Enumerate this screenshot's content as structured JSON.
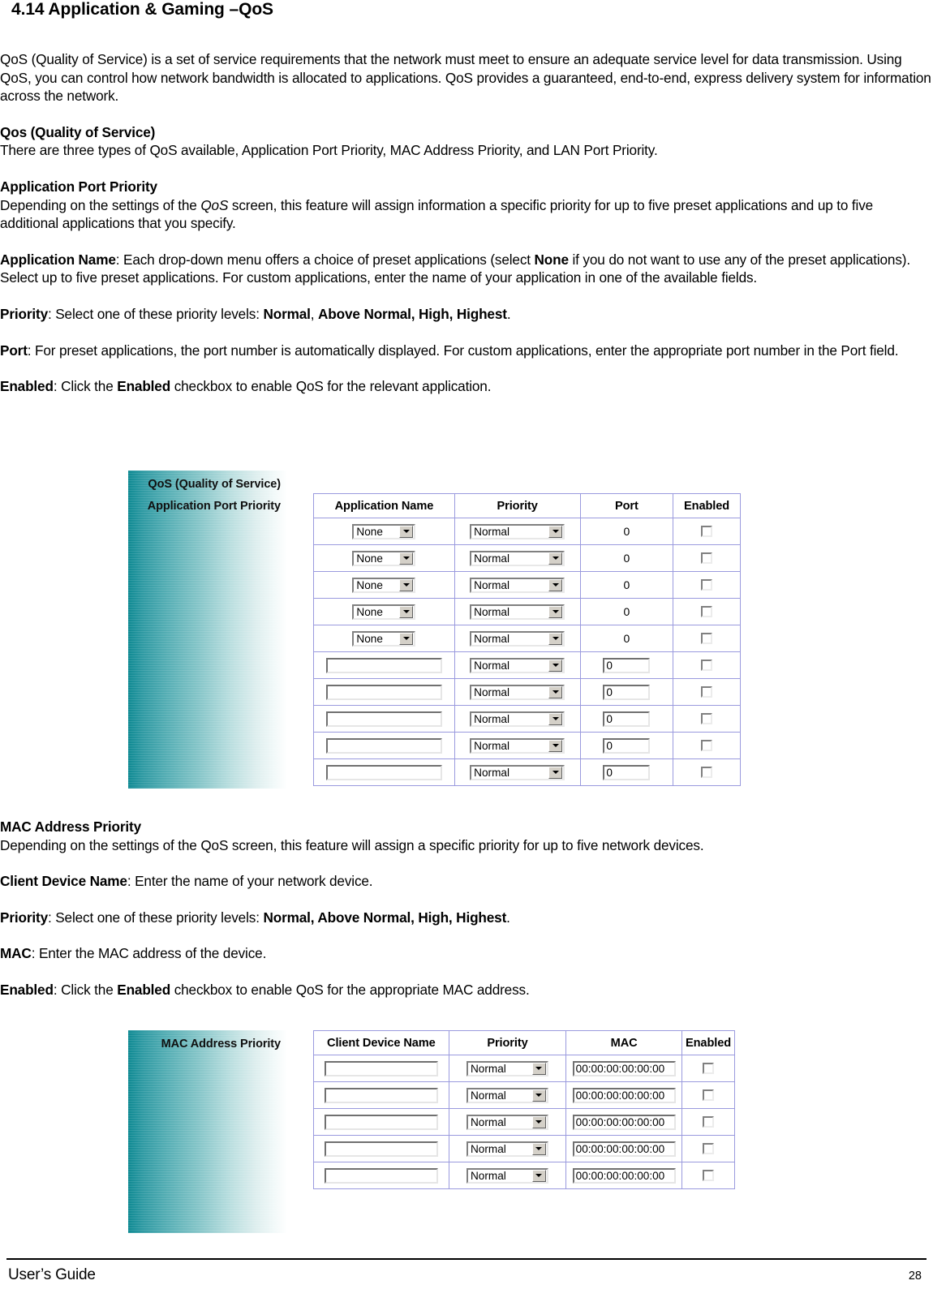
{
  "heading": "4.14 Application & Gaming –QoS",
  "intro": {
    "p1": "QoS (Quality of Service) is a set of service requirements that the network must meet to ensure an adequate service level for data transmission. Using QoS, you can control how network bandwidth is allocated to applications. QoS provides a guaranteed, end-to-end, express delivery system for information across the network."
  },
  "qos_section": {
    "heading": "Qos (Quality of Service)",
    "body": "There are three types of QoS available, Application Port Priority, MAC Address Priority, and LAN Port Priority."
  },
  "app_port_priority": {
    "heading": "Application Port Priority",
    "body_pre": "Depending on the settings of the ",
    "body_italic": "QoS",
    "body_post": " screen, this feature will assign information a specific priority for up to five preset applications and up to five additional applications that you specify.",
    "items": {
      "app_name_label": "Application Name",
      "app_name_text_a": ": Each drop-down menu offers a choice of preset applications (select ",
      "app_name_bold": "None",
      "app_name_text_b": " if you do not want to use any of the preset applications). Select up to five preset applications. For custom applications, enter the name of your application in one of the available fields.",
      "priority_label": "Priority",
      "priority_text_a": ": Select one of these priority levels: ",
      "priority_bold_a": "Normal",
      "priority_text_b": ", ",
      "priority_bold_b": "Above Normal, High, Highest",
      "priority_text_c": ".",
      "port_label": "Port",
      "port_text": ": For preset applications, the port number is automatically displayed. For custom applications, enter the appropriate port number in the Port field.",
      "enabled_label": "Enabled",
      "enabled_text_a": ": Click the ",
      "enabled_bold": "Enabled",
      "enabled_text_b": " checkbox to enable QoS for the relevant application."
    }
  },
  "figure_app": {
    "panel_label_1": "QoS (Quality of Service)",
    "panel_label_2": "Application Port Priority",
    "headers": [
      "Application Name",
      "Priority",
      "Port",
      "Enabled"
    ],
    "preset_rows": [
      {
        "app": "None",
        "priority": "Normal",
        "port": "0",
        "enabled": false
      },
      {
        "app": "None",
        "priority": "Normal",
        "port": "0",
        "enabled": false
      },
      {
        "app": "None",
        "priority": "Normal",
        "port": "0",
        "enabled": false
      },
      {
        "app": "None",
        "priority": "Normal",
        "port": "0",
        "enabled": false
      },
      {
        "app": "None",
        "priority": "Normal",
        "port": "0",
        "enabled": false
      }
    ],
    "custom_rows": [
      {
        "app": "",
        "priority": "Normal",
        "port": "0",
        "enabled": false
      },
      {
        "app": "",
        "priority": "Normal",
        "port": "0",
        "enabled": false
      },
      {
        "app": "",
        "priority": "Normal",
        "port": "0",
        "enabled": false
      },
      {
        "app": "",
        "priority": "Normal",
        "port": "0",
        "enabled": false
      },
      {
        "app": "",
        "priority": "Normal",
        "port": "0",
        "enabled": false
      }
    ]
  },
  "mac_address_priority": {
    "heading": "MAC Address Priority",
    "body": "Depending on the settings of the QoS screen, this feature will assign a specific priority for up to five network devices.",
    "items": {
      "client_label": "Client Device Name",
      "client_text": ": Enter the name of your network device.",
      "priority_label": "Priority",
      "priority_text_a": ": Select one of these priority levels: ",
      "priority_bold": "Normal, Above Normal, High, Highest",
      "priority_text_b": ".",
      "mac_label": "MAC",
      "mac_text": ": Enter the MAC address of the device.",
      "enabled_label": "Enabled",
      "enabled_text_a": ": Click the ",
      "enabled_bold": "Enabled",
      "enabled_text_b": " checkbox to enable QoS for the appropriate MAC address."
    }
  },
  "figure_mac": {
    "panel_label_1": "MAC Address Priority",
    "headers": [
      "Client Device Name",
      "Priority",
      "MAC",
      "Enabled"
    ],
    "rows": [
      {
        "client": "",
        "priority": "Normal",
        "mac": "00:00:00:00:00:00",
        "enabled": false
      },
      {
        "client": "",
        "priority": "Normal",
        "mac": "00:00:00:00:00:00",
        "enabled": false
      },
      {
        "client": "",
        "priority": "Normal",
        "mac": "00:00:00:00:00:00",
        "enabled": false
      },
      {
        "client": "",
        "priority": "Normal",
        "mac": "00:00:00:00:00:00",
        "enabled": false
      },
      {
        "client": "",
        "priority": "Normal",
        "mac": "00:00:00:00:00:00",
        "enabled": false
      }
    ]
  },
  "footer": {
    "left": "User’s Guide",
    "page_number": "28"
  },
  "colors": {
    "panel_gradient_start": "#0f8a93",
    "panel_gradient_end": "#ffffff",
    "table_border": "#9a9ade",
    "text": "#000000"
  }
}
